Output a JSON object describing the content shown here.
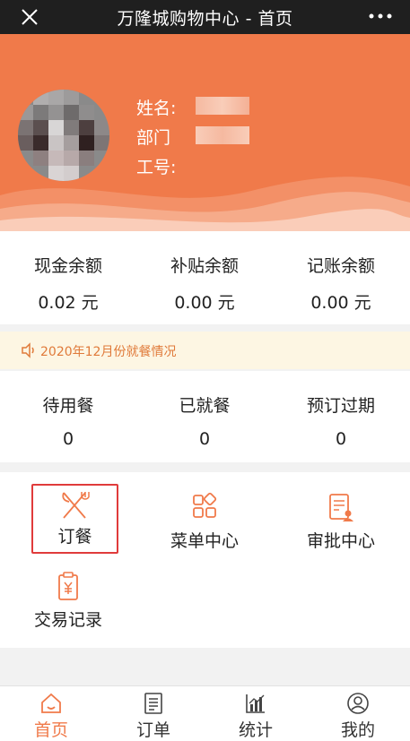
{
  "titlebar": {
    "title": "万隆城购物中心 - 首页"
  },
  "profile": {
    "name_label": "姓名:",
    "dept_label": "部门",
    "id_label": "工号:"
  },
  "balances": [
    {
      "label": "现金余额",
      "value": "0.02 元"
    },
    {
      "label": "补贴余额",
      "value": "0.00 元"
    },
    {
      "label": "记账余额",
      "value": "0.00 元"
    }
  ],
  "notice": {
    "text": "2020年12月份就餐情况"
  },
  "meals": [
    {
      "label": "待用餐",
      "value": "0"
    },
    {
      "label": "已就餐",
      "value": "0"
    },
    {
      "label": "预订过期",
      "value": "0"
    }
  ],
  "menu": [
    {
      "label": "订餐",
      "icon": "fork-knife-icon"
    },
    {
      "label": "菜单中心",
      "icon": "grid-icon"
    },
    {
      "label": "审批中心",
      "icon": "approval-doc-icon"
    },
    {
      "label": "交易记录",
      "icon": "receipt-yen-icon"
    }
  ],
  "tabs": [
    {
      "label": "首页",
      "icon": "home-icon",
      "active": true
    },
    {
      "label": "订单",
      "icon": "order-list-icon",
      "active": false
    },
    {
      "label": "统计",
      "icon": "chart-icon",
      "active": false
    },
    {
      "label": "我的",
      "icon": "user-icon",
      "active": false
    }
  ],
  "colors": {
    "accent": "#f07a4a",
    "notice_bg": "#fdf6e3",
    "notice_text": "#e07a3a",
    "selection": "#e03b3b",
    "titlebar": "#1f1f1f"
  }
}
